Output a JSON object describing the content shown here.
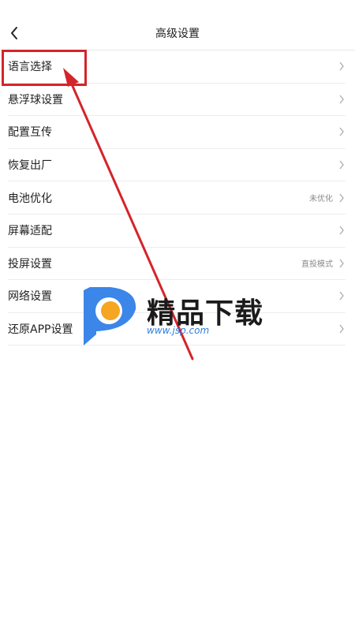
{
  "header": {
    "title": "高级设置",
    "back_icon": "back-arrow-icon"
  },
  "settings": {
    "items": [
      {
        "label": "语言选择",
        "value": ""
      },
      {
        "label": "悬浮球设置",
        "value": ""
      },
      {
        "label": "配置互传",
        "value": ""
      },
      {
        "label": "恢复出厂",
        "value": ""
      },
      {
        "label": "电池优化",
        "value": "未优化"
      },
      {
        "label": "屏幕适配",
        "value": ""
      },
      {
        "label": "投屏设置",
        "value": "直投模式"
      },
      {
        "label": "网络设置",
        "value": ""
      },
      {
        "label": "还原APP设置",
        "value": ""
      }
    ]
  },
  "annotation": {
    "highlight_color": "#d4242b"
  },
  "watermark": {
    "title": "精品下载",
    "url": "www.jsp.com"
  },
  "colors": {
    "divider": "#ececec",
    "text": "#222222",
    "secondary": "#8a8a8a",
    "chevron": "#b0b0b0"
  }
}
